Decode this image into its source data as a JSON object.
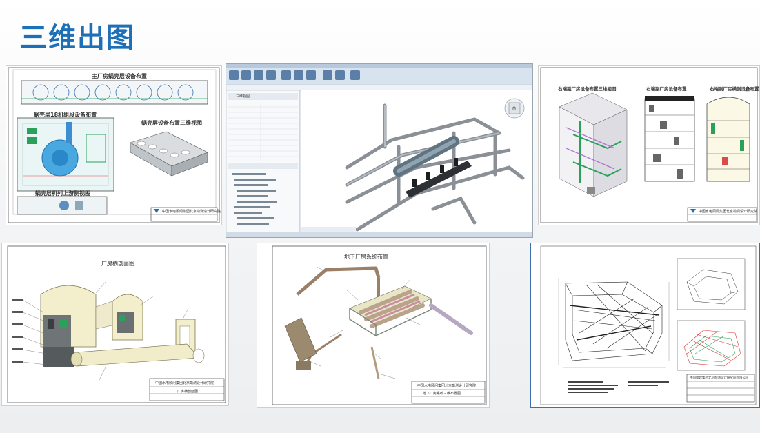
{
  "page": {
    "title": "三维出图",
    "accent_color": "#1d6fb8"
  },
  "panels": {
    "p1": {
      "titles": [
        "主厂房蜗壳层设备布置",
        "蜗壳层18机组段设备布置",
        "蜗壳层设备布置三维视图",
        "蜗壳层机列上游侧视图"
      ],
      "org": "中国水电顾问集团北京勘测设计研究院"
    },
    "p2": {
      "app": "Revit",
      "properties_header": "三维视图",
      "view_cube_label": "前"
    },
    "p3": {
      "titles": [
        "右端副厂房设备布置三维视图",
        "右端副厂房设备布置",
        "右端副厂房横剖设备布置"
      ],
      "org": "中国水电顾问集团北京勘测设计研究院"
    },
    "p4": {
      "title": "厂房横剖面图",
      "org": "中国水电顾问集团北京勘测设计研究院",
      "sheet": "厂房横剖面图"
    },
    "p5": {
      "title": "地下厂房系统布置",
      "org": "中国水电顾问集团北京勘测设计研究院",
      "sheet": "地下厂房系统三维布置图"
    },
    "p6": {
      "org": "中国电建集团北京勘测设计研究院有限公司"
    }
  }
}
